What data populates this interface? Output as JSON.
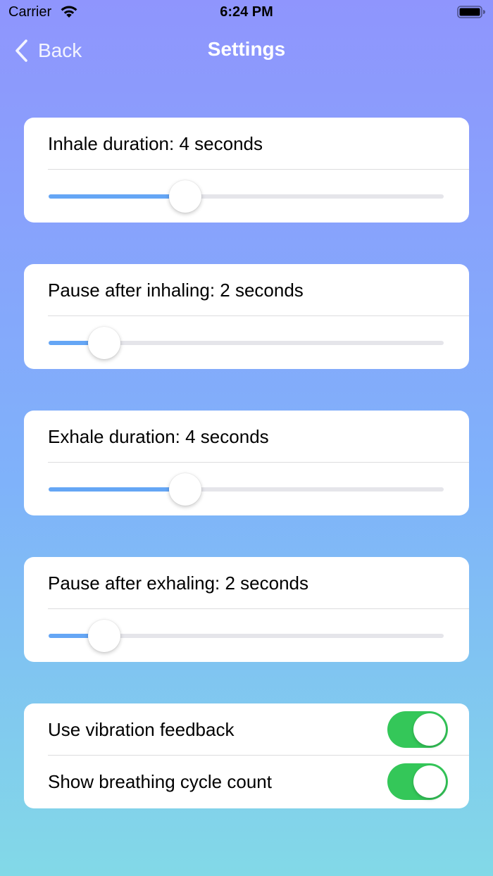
{
  "status_bar": {
    "carrier": "Carrier",
    "time": "6:24 PM",
    "icons": [
      "wifi-icon",
      "battery-icon"
    ]
  },
  "nav": {
    "back_label": "Back",
    "back_icon": "chevron-left-icon",
    "title": "Settings"
  },
  "sliders": [
    {
      "label": "Inhale duration: 4 seconds",
      "fraction": 0.345
    },
    {
      "label": "Pause after inhaling: 2 seconds",
      "fraction": 0.14
    },
    {
      "label": "Exhale duration: 4 seconds",
      "fraction": 0.345
    },
    {
      "label": "Pause after exhaling: 2 seconds",
      "fraction": 0.14
    }
  ],
  "toggles": [
    {
      "label": "Use vibration feedback",
      "on": true
    },
    {
      "label": "Show breathing cycle count",
      "on": true
    }
  ],
  "colors": {
    "accent": "#65a6f5",
    "toggle_on": "#34c759",
    "gradient_top": "#8f95fd",
    "gradient_bottom": "#82d9e7"
  }
}
